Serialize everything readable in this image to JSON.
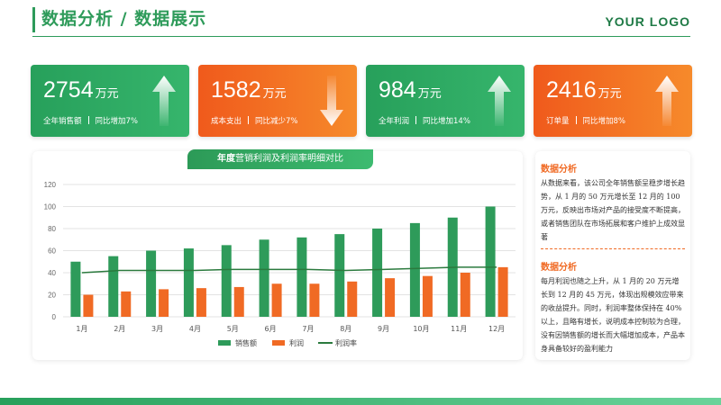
{
  "header": {
    "title": "数据分析 / 数据展示",
    "logo": "YOUR LOGO"
  },
  "cards": [
    {
      "value": "2754",
      "unit": "万元",
      "label": "全年销售额",
      "change": "同比增加7%",
      "color": "green",
      "trend": "up",
      "icon": "arrow-up-icon"
    },
    {
      "value": "1582",
      "unit": "万元",
      "label": "成本支出",
      "change": "同比减少7%",
      "color": "orange",
      "trend": "down",
      "icon": "arrow-down-icon"
    },
    {
      "value": "984",
      "unit": "万元",
      "label": "全年利润",
      "change": "同比增加14%",
      "color": "green",
      "trend": "up",
      "icon": "arrow-up-icon"
    },
    {
      "value": "2416",
      "unit": "万元",
      "label": "订单量",
      "change": "同比增加8%",
      "color": "orange",
      "trend": "up",
      "icon": "arrow-up-icon"
    }
  ],
  "chart_tab": {
    "bold": "年度",
    "rest": "营销利润及利润率明细对比"
  },
  "chart_data": {
    "type": "bar",
    "categories": [
      "1月",
      "2月",
      "3月",
      "4月",
      "5月",
      "6月",
      "7月",
      "8月",
      "9月",
      "10月",
      "11月",
      "12月"
    ],
    "series": [
      {
        "name": "销售额",
        "type": "bar",
        "color": "#2e9b5a",
        "values": [
          50,
          55,
          60,
          62,
          65,
          70,
          72,
          75,
          80,
          85,
          90,
          100
        ]
      },
      {
        "name": "利润",
        "type": "bar",
        "color": "#f06a24",
        "values": [
          20,
          23,
          25,
          26,
          27,
          30,
          30,
          32,
          35,
          37,
          40,
          45
        ]
      },
      {
        "name": "利润率",
        "type": "line",
        "color": "#2b7a3e",
        "values": [
          40,
          42,
          42,
          42,
          43,
          43,
          43,
          42,
          43,
          44,
          45,
          45
        ]
      }
    ],
    "ylim": [
      0,
      120
    ],
    "yticks": [
      0,
      20,
      40,
      60,
      80,
      100,
      120
    ],
    "grid": true,
    "legend": "bottom"
  },
  "side": {
    "h1": "数据分析",
    "p1": "从数据来看，该公司全年销售额呈稳步增长趋势，从 1 月的 50 万元增长至 12 月的 100 万元，反映出市场对产品的接受度不断提高，或者销售团队在市场拓展和客户维护上成效显著",
    "h2": "数据分析",
    "p2": "每月利润也随之上升，从 1 月的 20 万元增长到 12 月的 45 万元，体现出规模效应带来的收益提升。同时，利润率整体保持在 40% 以上，且略有增长，说明成本控制较为合理，没有因销售额的增长而大幅增加成本，产品本身具备较好的盈利能力"
  }
}
